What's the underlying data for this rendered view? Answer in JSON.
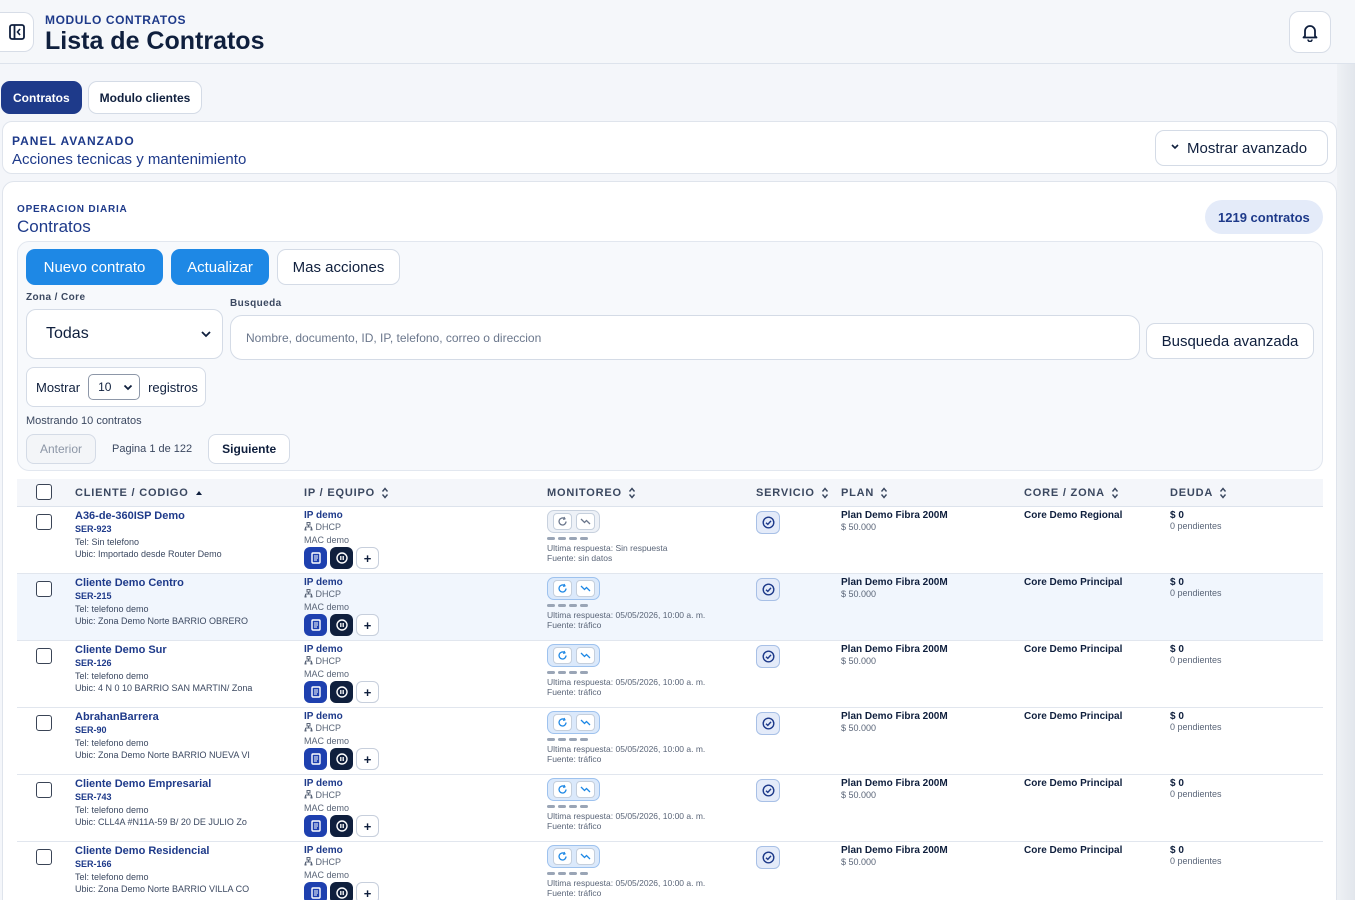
{
  "header": {
    "module": "MODULO CONTRATOS",
    "title": "Lista de Contratos"
  },
  "tabs": [
    {
      "label": "Contratos",
      "active": true
    },
    {
      "label": "Modulo clientes",
      "active": false
    }
  ],
  "advanced_panel": {
    "kicker": "PANEL AVANZADO",
    "subtitle": "Acciones tecnicas y mantenimiento",
    "toggle_label": "Mostrar avanzado"
  },
  "operation": {
    "kicker": "OPERACION DIARIA",
    "title": "Contratos",
    "count_badge": "1219 contratos"
  },
  "toolbar": {
    "new_label": "Nuevo contrato",
    "refresh_label": "Actualizar",
    "more_label": "Mas acciones"
  },
  "filters": {
    "zone_label": "Zona / Core",
    "zone_value": "Todas",
    "search_label": "Busqueda",
    "search_placeholder": "Nombre, documento, ID, IP, telefono, correo o direccion",
    "advanced_search_label": "Busqueda avanzada",
    "show_label": "Mostrar",
    "show_value": "10",
    "records_label": "registros",
    "showing_text": "Mostrando 10 contratos"
  },
  "pagination": {
    "prev_label": "Anterior",
    "info": "Pagina 1 de 122",
    "next_label": "Siguiente"
  },
  "table": {
    "headers": {
      "client": "CLIENTE / CODIGO",
      "ip": "IP / EQUIPO",
      "monitor": "MONITOREO",
      "service": "SERVICIO",
      "plan": "PLAN",
      "core": "CORE / ZONA",
      "debt": "DEUDA"
    },
    "rows": [
      {
        "name": "A36-de-360ISP Demo",
        "code": "SER-923",
        "tel": "Tel: Sin telefono",
        "ubic": "Ubic: Importado desde Router Demo",
        "ip": "IP demo",
        "dhcp": "DHCP",
        "mac": "MAC demo",
        "monitor_active": false,
        "last": "Ultima respuesta: Sin respuesta",
        "source": "Fuente: sin datos",
        "plan": "Plan Demo Fibra 200M",
        "price": "$ 50.000",
        "core": "Core Demo Regional",
        "debt": "$ 0",
        "pending": "0 pendientes"
      },
      {
        "name": "Cliente Demo Centro",
        "code": "SER-215",
        "tel": "Tel: telefono demo",
        "ubic": "Ubic: Zona Demo Norte BARRIO OBRERO",
        "ip": "IP demo",
        "dhcp": "DHCP",
        "mac": "MAC demo",
        "monitor_active": true,
        "last": "Ultima respuesta: 05/05/2026, 10:00 a. m.",
        "source": "Fuente: tráfico",
        "plan": "Plan Demo Fibra 200M",
        "price": "$ 50.000",
        "core": "Core Demo Principal",
        "debt": "$ 0",
        "pending": "0 pendientes"
      },
      {
        "name": "Cliente Demo Sur",
        "code": "SER-126",
        "tel": "Tel: telefono demo",
        "ubic": "Ubic: 4 N 0 10 BARRIO SAN MARTIN/ Zona",
        "ip": "IP demo",
        "dhcp": "DHCP",
        "mac": "MAC demo",
        "monitor_active": true,
        "last": "Ultima respuesta: 05/05/2026, 10:00 a. m.",
        "source": "Fuente: tráfico",
        "plan": "Plan Demo Fibra 200M",
        "price": "$ 50.000",
        "core": "Core Demo Principal",
        "debt": "$ 0",
        "pending": "0 pendientes"
      },
      {
        "name": "AbrahanBarrera",
        "code": "SER-90",
        "tel": "Tel: telefono demo",
        "ubic": "Ubic: Zona Demo Norte BARRIO NUEVA VI",
        "ip": "IP demo",
        "dhcp": "DHCP",
        "mac": "MAC demo",
        "monitor_active": true,
        "last": "Ultima respuesta: 05/05/2026, 10:00 a. m.",
        "source": "Fuente: tráfico",
        "plan": "Plan Demo Fibra 200M",
        "price": "$ 50.000",
        "core": "Core Demo Principal",
        "debt": "$ 0",
        "pending": "0 pendientes"
      },
      {
        "name": "Cliente Demo Empresarial",
        "code": "SER-743",
        "tel": "Tel: telefono demo",
        "ubic": "Ubic: CLL4A #N11A-59 B/ 20 DE JULIO Zo",
        "ip": "IP demo",
        "dhcp": "DHCP",
        "mac": "MAC demo",
        "monitor_active": true,
        "last": "Ultima respuesta: 05/05/2026, 10:00 a. m.",
        "source": "Fuente: tráfico",
        "plan": "Plan Demo Fibra 200M",
        "price": "$ 50.000",
        "core": "Core Demo Principal",
        "debt": "$ 0",
        "pending": "0 pendientes"
      },
      {
        "name": "Cliente Demo Residencial",
        "code": "SER-166",
        "tel": "Tel: telefono demo",
        "ubic": "Ubic: Zona Demo Norte BARRIO VILLA CO",
        "ip": "IP demo",
        "dhcp": "DHCP",
        "mac": "MAC demo",
        "monitor_active": true,
        "last": "Ultima respuesta: 05/05/2026, 10:00 a. m.",
        "source": "Fuente: tráfico",
        "plan": "Plan Demo Fibra 200M",
        "price": "$ 50.000",
        "core": "Core Demo Principal",
        "debt": "$ 0",
        "pending": "0 pendientes"
      }
    ]
  },
  "colors": {
    "navy": "#1e3a8a",
    "primary": "#1e88e5",
    "dark": "#0f1f3d"
  }
}
